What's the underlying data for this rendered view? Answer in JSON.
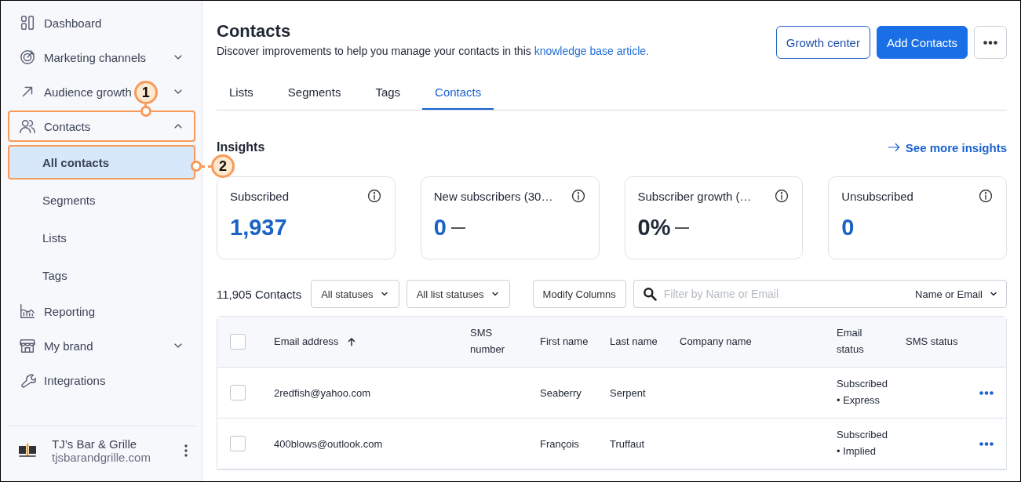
{
  "sidebar": {
    "items": [
      {
        "label": "Dashboard",
        "highlighted": false
      },
      {
        "label": "Marketing channels",
        "expanded": false,
        "highlighted": false
      },
      {
        "label": "Audience growth",
        "expanded": false,
        "highlighted": false
      },
      {
        "label": "Contacts",
        "expanded": true,
        "highlighted": true,
        "children": [
          {
            "label": "All contacts",
            "selected": true,
            "highlighted": true
          },
          {
            "label": "Segments",
            "selected": false,
            "highlighted": false
          },
          {
            "label": "Lists",
            "selected": false,
            "highlighted": false
          },
          {
            "label": "Tags",
            "selected": false,
            "highlighted": false
          }
        ]
      },
      {
        "label": "Reporting",
        "highlighted": false
      },
      {
        "label": "My brand",
        "expanded": false,
        "highlighted": false
      },
      {
        "label": "Integrations",
        "highlighted": false
      }
    ],
    "account": {
      "name": "TJ’s Bar & Grille",
      "domain": "tjsbarandgrille.com"
    }
  },
  "callouts": [
    {
      "number": "1"
    },
    {
      "number": "2"
    }
  ],
  "header": {
    "title": "Contacts",
    "description": "Discover improvements to help you manage your contacts in this ",
    "link": "knowledge base article.",
    "buttons": [
      {
        "label": "Growth center",
        "kind": "outline"
      },
      {
        "label": "Add Contacts",
        "kind": "primary"
      }
    ]
  },
  "tabs": [
    {
      "label": "Lists",
      "selected": false
    },
    {
      "label": "Segments",
      "selected": false
    },
    {
      "label": "Tags",
      "selected": false
    },
    {
      "label": "Contacts",
      "selected": true
    }
  ],
  "insights": {
    "title": "Insights",
    "link": "See more insights",
    "cards": [
      {
        "label": "Subscribed",
        "value": "1,937",
        "highlight": true,
        "trend": false
      },
      {
        "label": "New subscribers (30…",
        "value": "0",
        "highlight": true,
        "trend": true
      },
      {
        "label": "Subscriber growth (…",
        "value": "0%",
        "highlight": false,
        "trend": true
      },
      {
        "label": "Unsubscribed",
        "value": "0",
        "highlight": true,
        "trend": false
      }
    ]
  },
  "toolbar": {
    "count": "11,905 Contacts",
    "filters": [
      "All statuses",
      "All list statuses"
    ],
    "modify": "Modify Columns",
    "search": {
      "placeholder": "Filter by Name or Email",
      "scope": "Name or Email"
    }
  },
  "table": {
    "select_all_checked": false,
    "columns": [
      {
        "label": "Email address",
        "sorted": true
      },
      {
        "label": "SMS number",
        "sorted": false
      },
      {
        "label": "First name",
        "sorted": false
      },
      {
        "label": "Last name",
        "sorted": false
      },
      {
        "label": "Company name",
        "sorted": false
      },
      {
        "label": "Email status",
        "sorted": false
      },
      {
        "label": "SMS status",
        "sorted": false
      }
    ],
    "rows": [
      {
        "checked": false,
        "cells": [
          "2redfish@yahoo.com",
          "",
          "Seaberry",
          "Serpent",
          "",
          [
            "Subscribed",
            "• Express"
          ],
          ""
        ]
      },
      {
        "checked": false,
        "cells": [
          "400blows@outlook.com",
          "",
          "François",
          "Truffaut",
          "",
          [
            "Subscribed",
            "• Implied"
          ],
          ""
        ]
      }
    ]
  }
}
